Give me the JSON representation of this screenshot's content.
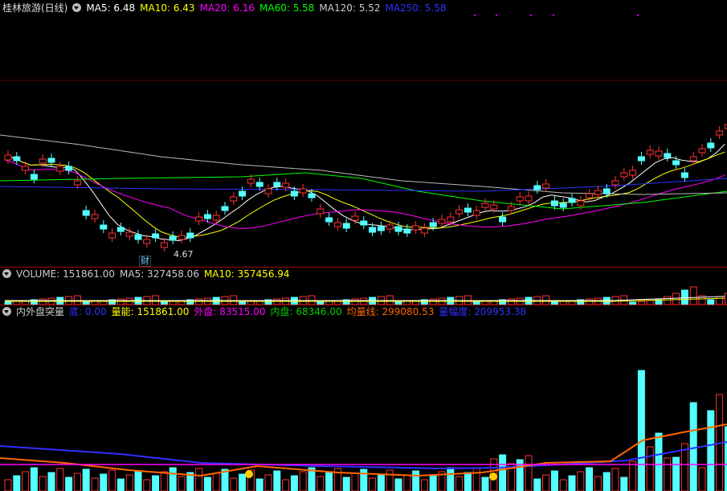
{
  "main": {
    "title": "桂林旅游(日线)",
    "ma": [
      {
        "label": "MA5: 6.48",
        "color": "#ffffff"
      },
      {
        "label": "MA10: 6.43",
        "color": "#ffff00"
      },
      {
        "label": "MA20: 6.16",
        "color": "#ff00ff"
      },
      {
        "label": "MA60: 5.58",
        "color": "#00ff00"
      },
      {
        "label": "MA120: 5.52",
        "color": "#cccccc"
      },
      {
        "label": "MA250: 5.58",
        "color": "#3030ff"
      }
    ],
    "low_label": "4.67",
    "event_badge": "财"
  },
  "volume": {
    "labels": [
      {
        "label": "VOLUME: 151861.00",
        "color": "#cccccc"
      },
      {
        "label": "MA5: 327458.06",
        "color": "#cccccc"
      },
      {
        "label": "MA10: 357456.94",
        "color": "#ffff00"
      }
    ]
  },
  "indicator": {
    "name": "内外盘突量",
    "labels": [
      {
        "label": "底: 0.00",
        "color": "#3030ff"
      },
      {
        "label": "量能: 151861.00",
        "color": "#ffff00"
      },
      {
        "label": "外盘: 83515.00",
        "color": "#ff00ff"
      },
      {
        "label": "内盘: 68346.00",
        "color": "#00cc00"
      },
      {
        "label": "均量线: 299080.53",
        "color": "#ff6600"
      },
      {
        "label": "量幅度: 209953.38",
        "color": "#3030ff"
      }
    ]
  },
  "colors": {
    "up": "#ff3232",
    "down": "#54ffff",
    "bg": "#000000",
    "grid": "#8b0000"
  }
}
